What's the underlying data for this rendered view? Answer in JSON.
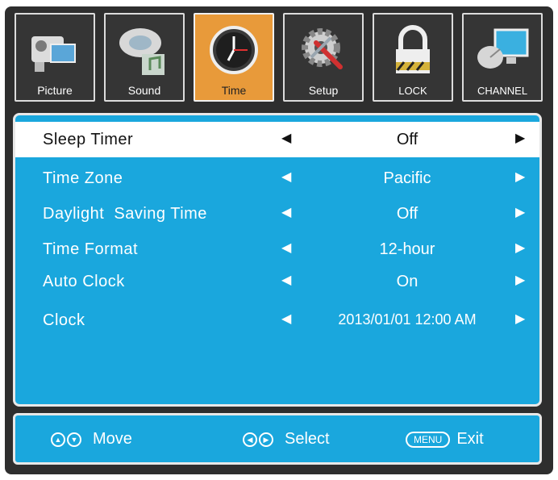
{
  "tabs": [
    {
      "label": "Picture",
      "icon": "camera-icon"
    },
    {
      "label": "Sound",
      "icon": "speaker-icon"
    },
    {
      "label": "Time",
      "icon": "clock-icon"
    },
    {
      "label": "Setup",
      "icon": "gear-wrench-icon"
    },
    {
      "label": "LOCK",
      "icon": "lock-icon"
    },
    {
      "label": "CHANNEL",
      "icon": "satellite-icon"
    }
  ],
  "active_tab": "Time",
  "rows": [
    {
      "name": "Sleep Timer",
      "value": "Off"
    },
    {
      "name": "Time Zone",
      "value": "Pacific"
    },
    {
      "name": "Daylight  Saving Time",
      "value": "Off"
    },
    {
      "name": "Time Format",
      "value": "12-hour"
    },
    {
      "name": "Auto Clock",
      "value": "On"
    },
    {
      "name": "Clock",
      "value": "2013/01/01 12:00 AM"
    }
  ],
  "arrows": {
    "left": "◀",
    "right": "▶"
  },
  "footer": {
    "move_label": "Move",
    "select_label": "Select",
    "menu_key": "MENU",
    "exit_label": "Exit"
  },
  "colors": {
    "panel": "#1aa7dd",
    "active_tab": "#e89a3a",
    "frame": "#2e2e2e"
  }
}
